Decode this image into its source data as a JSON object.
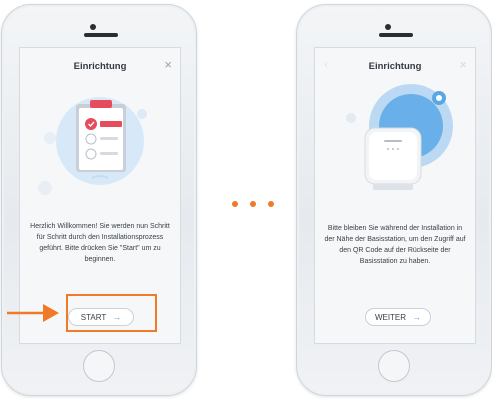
{
  "left_screen": {
    "title": "Einrichtung",
    "close_icon_glyph": "×",
    "body_text": "Herzlich Willkommen! Sie werden nun Schritt für Schritt durch den Installationsprozess geführt. Bitte drücken Sie \"Start\" um zu beginnen.",
    "button_label": "START",
    "button_arrow": "→"
  },
  "right_screen": {
    "title": "Einrichtung",
    "close_icon_glyph": "×",
    "back_icon_glyph": "‹",
    "body_text": "Bitte bleiben Sie während der Installation in der Nähe der Basisstation, um den Zugriff auf den QR Code auf der Rückseite der Basisstation zu haben.",
    "button_label": "WEITER",
    "button_arrow": "→"
  },
  "colors": {
    "accent_orange": "#f07a27",
    "accent_blue": "#5aa7e6",
    "clipboard_red": "#e74c5e"
  }
}
